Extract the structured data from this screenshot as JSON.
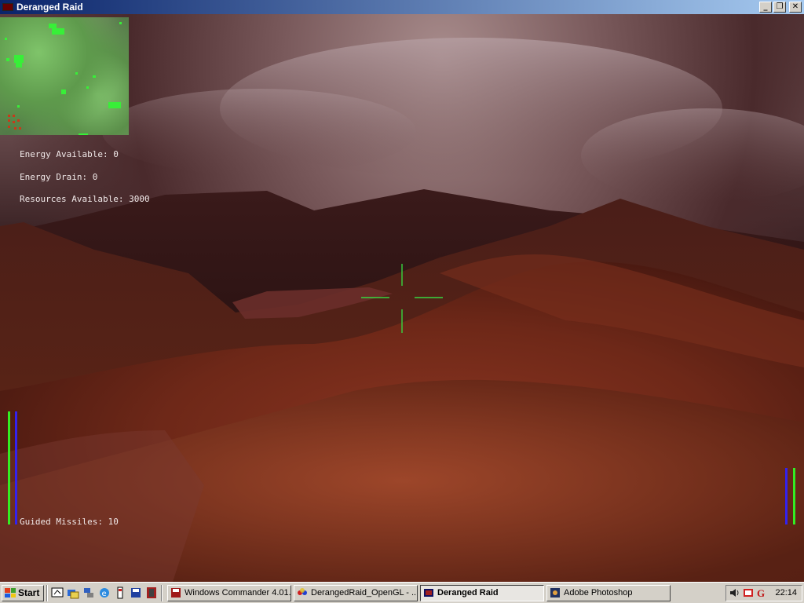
{
  "window": {
    "title": "Deranged Raid",
    "controls": [
      "minimize-icon",
      "restore-icon",
      "close-icon"
    ]
  },
  "hud": {
    "energy_available": "Energy Available: 0",
    "energy_drain": "Energy Drain: 0",
    "resources_available": "Resources Available: 3000",
    "guided_missiles": "Guided Missiles: 10",
    "crosshair_color": "#39d640",
    "bar_green": "#33ee22",
    "bar_blue": "#3322ee"
  },
  "taskbar": {
    "start_label": "Start",
    "quick_launch": [
      "show-desktop-icon",
      "explorer-icon",
      "network-icon",
      "internet-explorer-icon",
      "help-icon",
      "save-icon",
      "film-icon"
    ],
    "tasks": [
      {
        "label": "Windows Commander 4.01...",
        "icon": "floppy-icon",
        "active": false
      },
      {
        "label": "DerangedRaid_OpenGL - ...",
        "icon": "paint-icon",
        "active": false
      },
      {
        "label": "Deranged Raid",
        "icon": "game-icon",
        "active": true
      },
      {
        "label": "Adobe Photoshop",
        "icon": "photoshop-icon",
        "active": false
      }
    ],
    "tray_icons": [
      "speaker-icon",
      "keyboard-icon",
      "g-icon"
    ],
    "clock": "22:14"
  }
}
